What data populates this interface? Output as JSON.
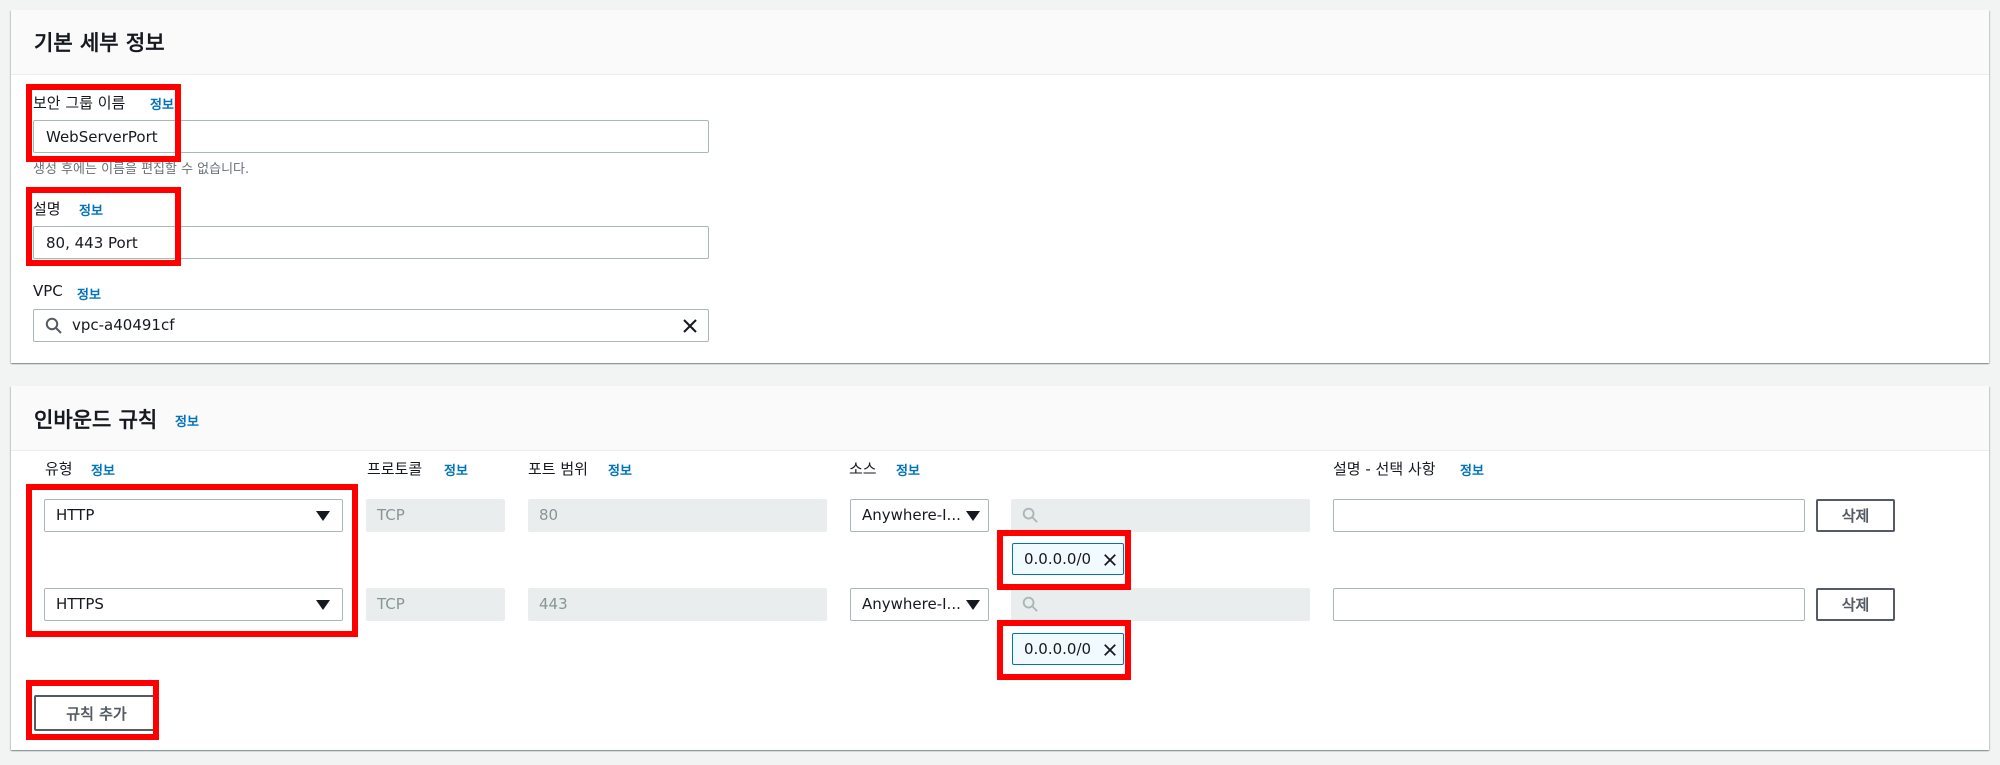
{
  "basic": {
    "title": "기본 세부 정보",
    "name_label": "보안 그룹 이름",
    "name_info": "정보",
    "name_value": "WebServerPort",
    "name_hint": "생성 후에는 이름을 편집할 수 없습니다.",
    "desc_label": "설명",
    "desc_info": "정보",
    "desc_value": "80, 443 Port",
    "vpc_label": "VPC",
    "vpc_info": "정보",
    "vpc_value": "vpc-a40491cf",
    "search_icon": "search-icon",
    "clear_icon": "close-icon"
  },
  "inbound": {
    "title": "인바운드 규칙",
    "title_info": "정보",
    "columns": {
      "type": "유형",
      "type_info": "정보",
      "protocol": "프로토콜",
      "protocol_info": "정보",
      "port": "포트 범위",
      "port_info": "정보",
      "source": "소스",
      "source_info": "정보",
      "description": "설명 - 선택 사항",
      "description_info": "정보"
    },
    "rules": [
      {
        "type": "HTTP",
        "protocol": "TCP",
        "port": "80",
        "source_type": "Anywhere-I...",
        "search_value": "",
        "cidr": "0.0.0.0/0",
        "description": "",
        "delete_label": "삭제"
      },
      {
        "type": "HTTPS",
        "protocol": "TCP",
        "port": "443",
        "source_type": "Anywhere-I...",
        "search_value": "",
        "cidr": "0.0.0.0/0",
        "description": "",
        "delete_label": "삭제"
      }
    ],
    "add_rule_label": "규칙 추가"
  },
  "colors": {
    "info_link": "#0073bb",
    "highlight": "#ff0000",
    "token_border": "#0073bb",
    "token_bg": "#f1faff",
    "disabled_bg": "#eaeded"
  }
}
